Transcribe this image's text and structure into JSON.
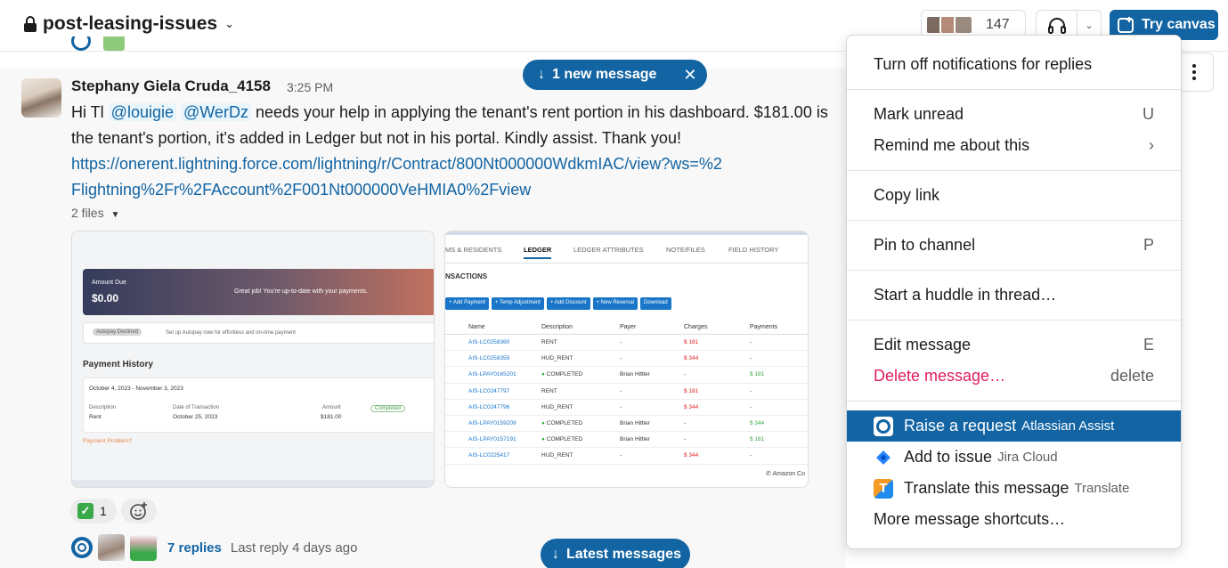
{
  "channel": {
    "name": "post-leasing-issues"
  },
  "header": {
    "member_count": "147",
    "canvas_label": "Try canvas"
  },
  "message": {
    "sender": "Stephany Giela Cruda_4158",
    "time": "3:25 PM",
    "text_start": "Hi Tl ",
    "mention1": "@louigie",
    "mention2": "@WerDz",
    "text_rest": " needs your help in applying the tenant's rent portion in his dashboard. $181.00 is the tenant's portion, it's added in Ledger but not in his portal. Kindly assist. Thank you!",
    "link": "https://onerent.lightning.force.com/lightning/r/Contract/800Nt000000WdkmIAC/view?ws=%2Flightning%2Fr%2FAccount%2F001Nt000000VeHMIA0%2Fview",
    "files_label": "2 files"
  },
  "screenshot1": {
    "amount_due_label": "Amount Due",
    "amount": "$0.00",
    "great_job": "Great job! You're up-to-date with your payments.",
    "autopay_badge": "Autopay Declined",
    "autopay_text": "Set up Autopay now for effortless and on-time payment",
    "history_title": "Payment History",
    "date_range": "October 4, 2023 - November 3, 2023",
    "col_desc": "Description",
    "col_date": "Date of Transaction",
    "col_amount": "Amount",
    "row_desc": "Rent",
    "row_date": "October 25, 2023",
    "row_amount": "$181.00",
    "status": "Completed",
    "problem": "Payment Problem?"
  },
  "screenshot2": {
    "tabs": [
      "MS & RESIDENTS",
      "LEDGER",
      "LEDGER ATTRIBUTES",
      "NOTE/FILES",
      "FIELD HISTORY"
    ],
    "section": "NSACTIONS",
    "buttons": [
      "+ Add Payment",
      "+ Temp Adjustment",
      "+ Add Discount",
      "+ New Reversal",
      "Download"
    ],
    "headers": [
      "Name",
      "Description",
      "Payer",
      "Charges",
      "Payments"
    ],
    "rows": [
      [
        "AIS-LC0258360",
        "RENT",
        "-",
        "$ 181",
        "-"
      ],
      [
        "AIS-LC0258359",
        "HUD_RENT",
        "-",
        "$ 344",
        "-"
      ],
      [
        "AIS-LPAY0165201",
        "COMPLETED",
        "Brian Hittler",
        "-",
        "$ 181"
      ],
      [
        "AIS-LC0247797",
        "RENT",
        "-",
        "$ 181",
        "-"
      ],
      [
        "AIS-LC0247796",
        "HUD_RENT",
        "-",
        "$ 344",
        "-"
      ],
      [
        "AIS-LPAY0159209",
        "COMPLETED",
        "Brian Hittler",
        "-",
        "$ 344"
      ],
      [
        "AIS-LPAY0157191",
        "COMPLETED",
        "Brian Hittler",
        "-",
        "$ 181"
      ],
      [
        "AIS-LC0225417",
        "HUD_RENT",
        "-",
        "$ 344",
        "-"
      ]
    ],
    "footer": "Amazon Co"
  },
  "reactions": {
    "check_count": "1"
  },
  "thread": {
    "replies": "7 replies",
    "last_reply": "Last reply 4 days ago"
  },
  "banners": {
    "new_message": "1 new message",
    "latest": "Latest messages"
  },
  "menu": {
    "turn_off": "Turn off notifications for replies",
    "mark_unread": "Mark unread",
    "mark_unread_key": "U",
    "remind": "Remind me about this",
    "remind_key": "›",
    "copy_link": "Copy link",
    "pin": "Pin to channel",
    "pin_key": "P",
    "huddle": "Start a huddle in thread…",
    "edit": "Edit message",
    "edit_key": "E",
    "delete": "Delete message…",
    "delete_key": "delete",
    "raise": "Raise a request",
    "raise_app": "Atlassian Assist",
    "add_issue": "Add to issue",
    "add_issue_app": "Jira Cloud",
    "translate": "Translate this message",
    "translate_app": "Translate",
    "more": "More message shortcuts…"
  }
}
